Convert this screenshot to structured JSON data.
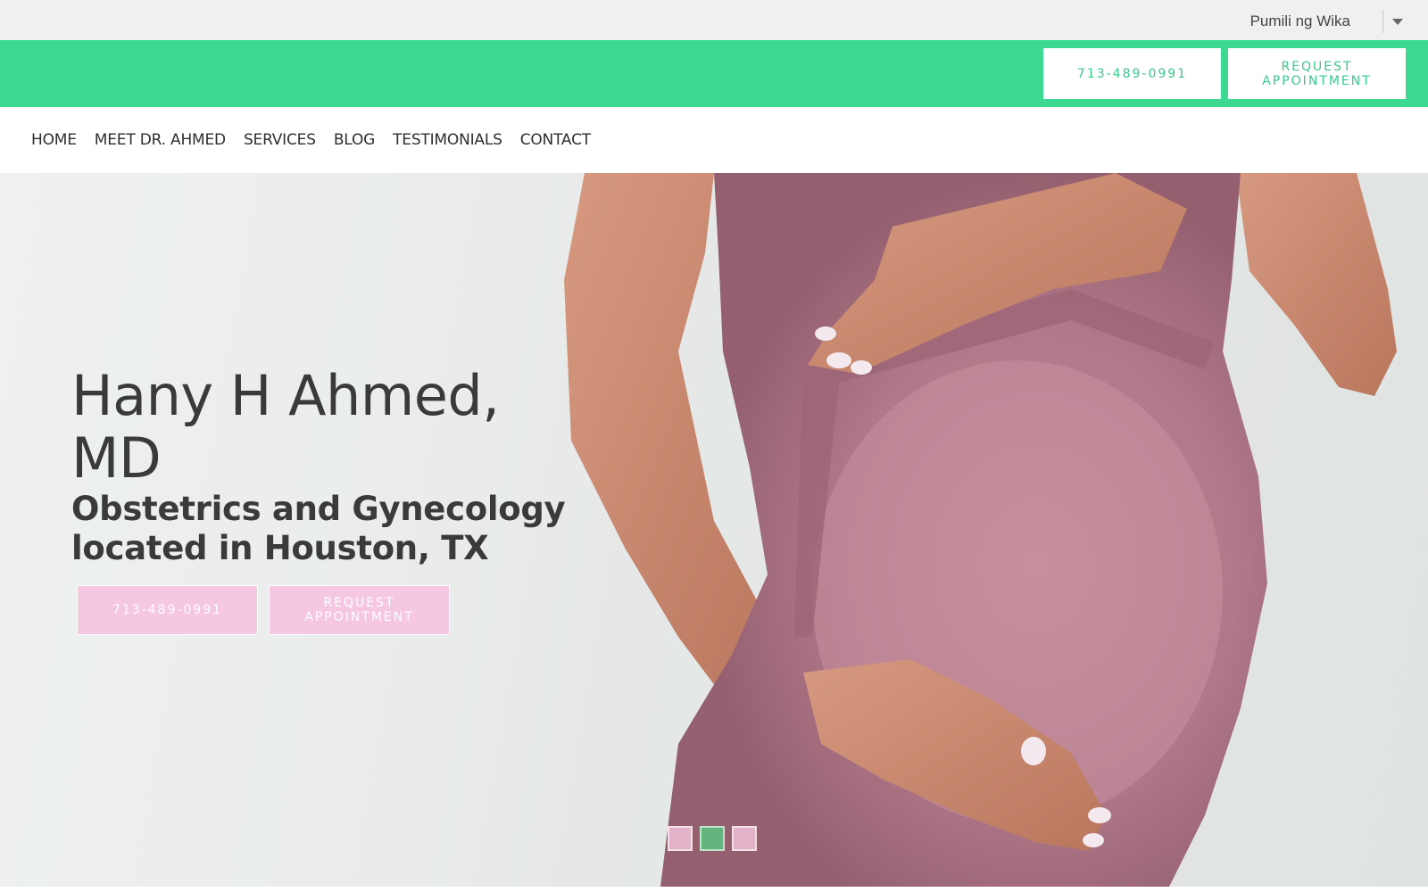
{
  "language_selector": {
    "label": "Pumili ng Wika"
  },
  "header": {
    "phone_button": "713-489-0991",
    "appointment_button": "REQUEST APPOINTMENT"
  },
  "nav": {
    "items": [
      {
        "label": "HOME"
      },
      {
        "label": "MEET DR. AHMED"
      },
      {
        "label": "SERVICES"
      },
      {
        "label": "BLOG"
      },
      {
        "label": "TESTIMONIALS"
      },
      {
        "label": "CONTACT"
      }
    ]
  },
  "hero": {
    "title": "Hany H Ahmed, MD",
    "subtitle": "Obstetrics and Gynecology located in Houston, TX",
    "phone_button": "713-489-0991",
    "appointment_button": "REQUEST APPOINTMENT",
    "slides": [
      {
        "active": false
      },
      {
        "active": true
      },
      {
        "active": false
      }
    ]
  },
  "colors": {
    "brand_green": "#3dd892",
    "accent_pink": "#f6c7e0",
    "dot_active": "#63b57d",
    "dot_inactive": "#e3b1c8"
  }
}
